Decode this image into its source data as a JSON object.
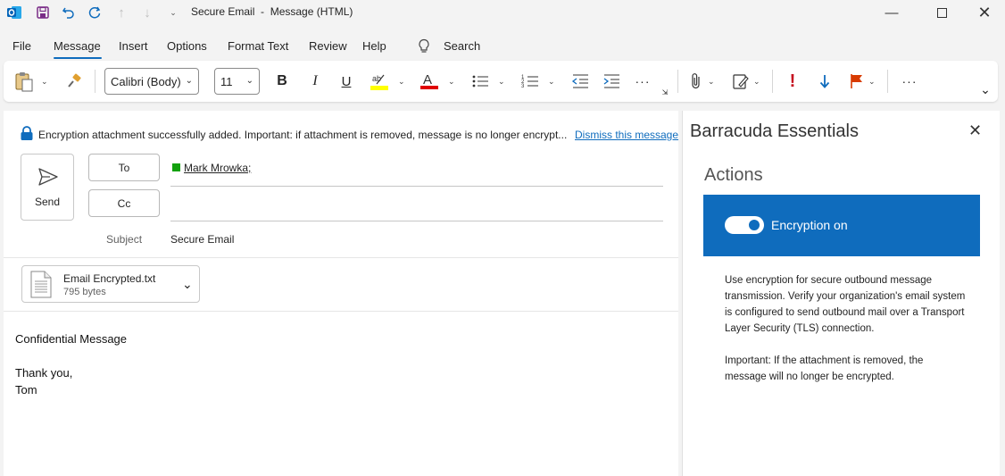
{
  "titlebar": {
    "title": "Secure Email  -  Message (HTML)",
    "icons": [
      "outlook-icon",
      "save-icon",
      "undo-icon",
      "redo-icon",
      "up-icon",
      "down-icon",
      "customize-icon"
    ],
    "window_controls": [
      "minimize-icon",
      "maximize-icon",
      "close-icon"
    ]
  },
  "menu": {
    "tabs": [
      "File",
      "Message",
      "Insert",
      "Options",
      "Format Text",
      "Review",
      "Help"
    ],
    "active": "Message",
    "search_label": "Search"
  },
  "ribbon": {
    "font_name": "Calibri (Body)",
    "font_size": "11",
    "bold": "B",
    "italic": "I",
    "underline": "U",
    "more": "···",
    "importance_high": "!",
    "colors": {
      "highlight": "#ffff00",
      "font_color": "#e00000",
      "flag": "#d83b01",
      "importance": "#c50f1f",
      "accent": "#0f6cbd"
    }
  },
  "compose": {
    "info_text": "Encryption attachment successfully added. Important: if attachment is removed, message is no longer encrypt...",
    "dismiss_label": "Dismiss this message",
    "send_label": "Send",
    "to_label": "To",
    "cc_label": "Cc",
    "recipient": "Mark Mrowka;",
    "recipient_status_color": "#13a10e",
    "subject_label": "Subject",
    "subject_value": "Secure Email",
    "attachment": {
      "name": "Email Encrypted.txt",
      "size": "795 bytes"
    },
    "body": [
      "Confidential Message",
      "Thank you,",
      "Tom"
    ]
  },
  "sidepanel": {
    "title": "Barracuda Essentials",
    "actions_heading": "Actions",
    "toggle_label": "Encryption on",
    "toggle_on": true,
    "description": "Use encryption for secure outbound message transmission. Verify your organization's email system is configured to send outbound mail over a Transport Layer Security (TLS) connection.",
    "important": "Important: If the attachment is removed, the message will no longer be encrypted."
  }
}
